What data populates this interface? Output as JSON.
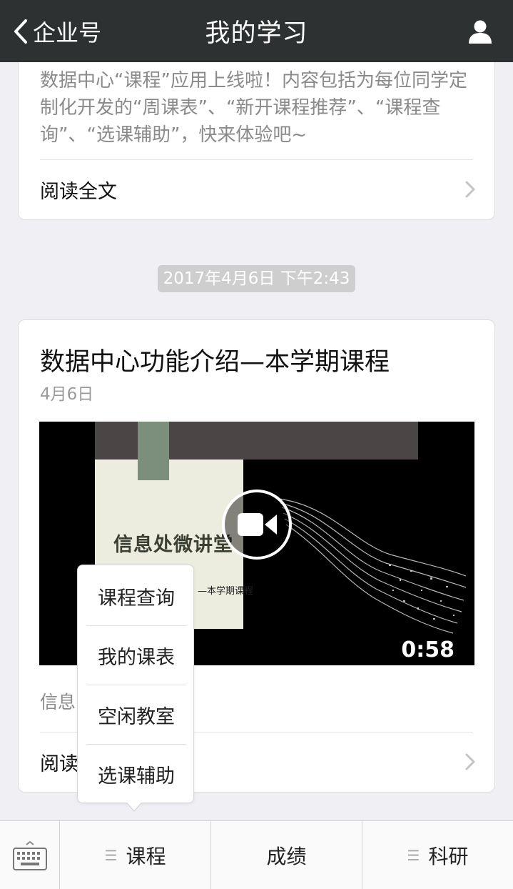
{
  "navbar": {
    "back_label": "企业号",
    "title": "我的学习"
  },
  "top_card": {
    "summary": "数据中心“课程”应用上线啦！内容包括为每位同学定制化开发的“周课表”、“新开课程推荐”、“课程查询”、“选课辅助”，快来体验吧~",
    "read_full": "阅读全文"
  },
  "timestamp": "2017年4月6日 下午2:43",
  "main_card": {
    "title": "数据中心功能介绍—本学期课程",
    "date": "4月6日",
    "video": {
      "slide_title": "信息处微讲堂",
      "slide_subtitle": "—本学期课程",
      "duration": "0:58"
    },
    "source_partial": "信息",
    "read_partial": "阅读"
  },
  "popup_menu": {
    "items": [
      "课程查询",
      "我的课表",
      "空闲教室",
      "选课辅助"
    ]
  },
  "bottom_menu": {
    "keyboard_icon": "keyboard-icon",
    "items": [
      {
        "label": "课程",
        "has_submenu": true
      },
      {
        "label": "成绩",
        "has_submenu": false
      },
      {
        "label": "科研",
        "has_submenu": true
      }
    ]
  },
  "colors": {
    "navbar_bg": "#2e3132",
    "page_bg": "#efeff4",
    "timestamp_bg": "#cececf"
  }
}
